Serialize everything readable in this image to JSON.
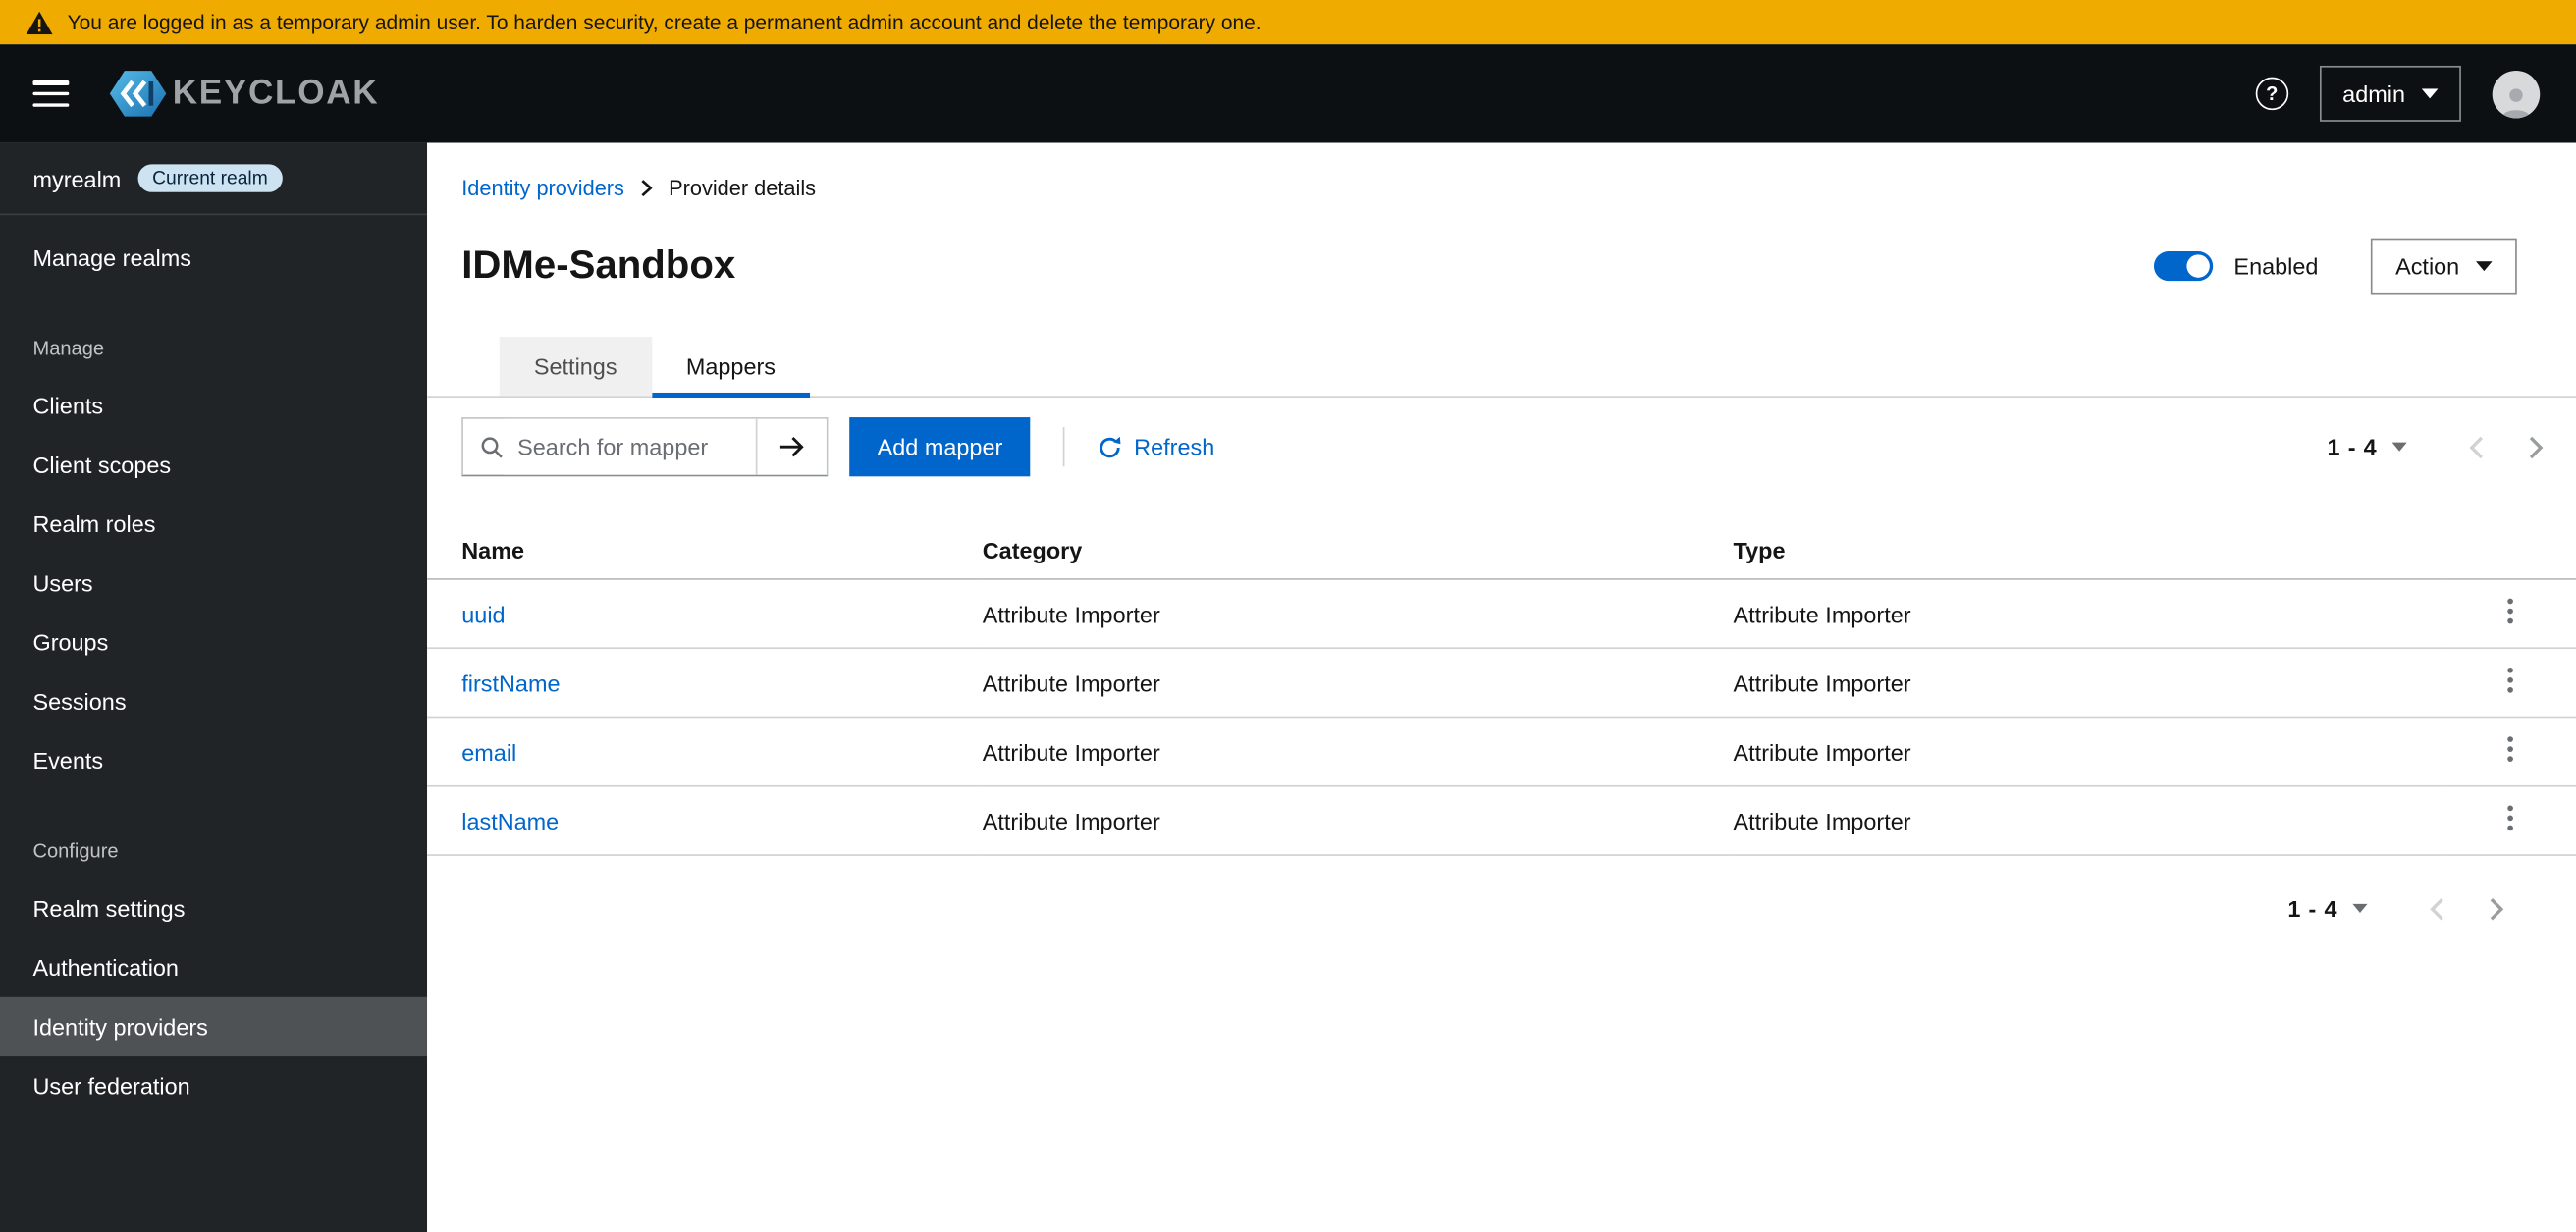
{
  "banner": {
    "text": "You are logged in as a temporary admin user. To harden security, create a permanent admin account and delete the temporary one."
  },
  "header": {
    "brand": "KEYCLOAK",
    "user_menu_label": "admin"
  },
  "sidebar": {
    "realm_name": "myrealm",
    "realm_badge": "Current realm",
    "manage_realms_label": "Manage realms",
    "sections": [
      {
        "label": "Manage",
        "items": [
          {
            "label": "Clients"
          },
          {
            "label": "Client scopes"
          },
          {
            "label": "Realm roles"
          },
          {
            "label": "Users"
          },
          {
            "label": "Groups"
          },
          {
            "label": "Sessions"
          },
          {
            "label": "Events"
          }
        ]
      },
      {
        "label": "Configure",
        "items": [
          {
            "label": "Realm settings"
          },
          {
            "label": "Authentication"
          },
          {
            "label": "Identity providers",
            "current": true
          },
          {
            "label": "User federation"
          }
        ]
      }
    ]
  },
  "breadcrumb": {
    "items": [
      "Identity providers",
      "Provider details"
    ]
  },
  "page": {
    "title": "IDMe-Sandbox",
    "enabled_label": "Enabled",
    "enabled_state": "on",
    "action_label": "Action"
  },
  "tabs": [
    {
      "label": "Settings",
      "active": false
    },
    {
      "label": "Mappers",
      "active": true
    }
  ],
  "toolbar": {
    "search_placeholder": "Search for mapper",
    "search_value": "",
    "add_mapper_label": "Add mapper",
    "refresh_label": "Refresh",
    "pagination_range": "1 - 4"
  },
  "table": {
    "columns": [
      "Name",
      "Category",
      "Type"
    ],
    "rows": [
      {
        "name": "uuid",
        "category": "Attribute Importer",
        "type": "Attribute Importer"
      },
      {
        "name": "firstName",
        "category": "Attribute Importer",
        "type": "Attribute Importer"
      },
      {
        "name": "email",
        "category": "Attribute Importer",
        "type": "Attribute Importer"
      },
      {
        "name": "lastName",
        "category": "Attribute Importer",
        "type": "Attribute Importer"
      }
    ]
  },
  "pagination_bottom": {
    "range": "1 - 4"
  },
  "colors": {
    "accent": "#0066cc",
    "warning_banner": "#f0ab00",
    "masthead": "#0d1013",
    "sidebar": "#212427",
    "sidebar_current_item": "#4f5255",
    "toggle_on": "#0066cc"
  }
}
